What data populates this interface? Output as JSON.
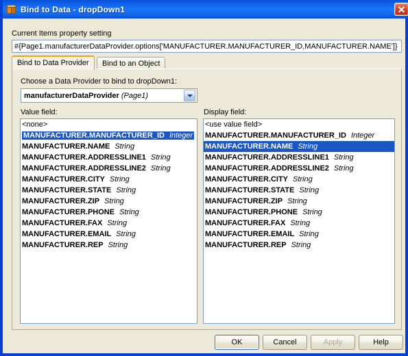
{
  "window": {
    "title": "Bind to Data - dropDown1",
    "icon": "cube-icon",
    "close_label": "×"
  },
  "property": {
    "label": "Current Items property setting",
    "value": "#{Page1.manufacturerDataProvider.options['MANUFACTURER.MANUFACTURER_ID,MANUFACTURER.NAME']}"
  },
  "tabs": [
    {
      "label": "Bind to Data Provider",
      "active": true
    },
    {
      "label": "Bind to an Object",
      "active": false
    }
  ],
  "provider": {
    "label": "Choose a Data Provider to bind to dropDown1:",
    "selected_name": "manufacturerDataProvider",
    "selected_scope": "(Page1)"
  },
  "value_field": {
    "label": "Value field:",
    "items": [
      {
        "name": "<none>",
        "type": "",
        "plain": true,
        "selected": false
      },
      {
        "name": "MANUFACTURER.MANUFACTURER_ID",
        "type": "Integer",
        "selected": true
      },
      {
        "name": "MANUFACTURER.NAME",
        "type": "String",
        "selected": false
      },
      {
        "name": "MANUFACTURER.ADDRESSLINE1",
        "type": "String",
        "selected": false
      },
      {
        "name": "MANUFACTURER.ADDRESSLINE2",
        "type": "String",
        "selected": false
      },
      {
        "name": "MANUFACTURER.CITY",
        "type": "String",
        "selected": false
      },
      {
        "name": "MANUFACTURER.STATE",
        "type": "String",
        "selected": false
      },
      {
        "name": "MANUFACTURER.ZIP",
        "type": "String",
        "selected": false
      },
      {
        "name": "MANUFACTURER.PHONE",
        "type": "String",
        "selected": false
      },
      {
        "name": "MANUFACTURER.FAX",
        "type": "String",
        "selected": false
      },
      {
        "name": "MANUFACTURER.EMAIL",
        "type": "String",
        "selected": false
      },
      {
        "name": "MANUFACTURER.REP",
        "type": "String",
        "selected": false
      }
    ]
  },
  "display_field": {
    "label": "Display field:",
    "items": [
      {
        "name": "<use value field>",
        "type": "",
        "plain": true,
        "selected": false
      },
      {
        "name": "MANUFACTURER.MANUFACTURER_ID",
        "type": "Integer",
        "selected": false
      },
      {
        "name": "MANUFACTURER.NAME",
        "type": "String",
        "selected": true
      },
      {
        "name": "MANUFACTURER.ADDRESSLINE1",
        "type": "String",
        "selected": false
      },
      {
        "name": "MANUFACTURER.ADDRESSLINE2",
        "type": "String",
        "selected": false
      },
      {
        "name": "MANUFACTURER.CITY",
        "type": "String",
        "selected": false
      },
      {
        "name": "MANUFACTURER.STATE",
        "type": "String",
        "selected": false
      },
      {
        "name": "MANUFACTURER.ZIP",
        "type": "String",
        "selected": false
      },
      {
        "name": "MANUFACTURER.PHONE",
        "type": "String",
        "selected": false
      },
      {
        "name": "MANUFACTURER.FAX",
        "type": "String",
        "selected": false
      },
      {
        "name": "MANUFACTURER.EMAIL",
        "type": "String",
        "selected": false
      },
      {
        "name": "MANUFACTURER.REP",
        "type": "String",
        "selected": false
      }
    ]
  },
  "buttons": [
    {
      "label": "OK",
      "default": true,
      "disabled": false
    },
    {
      "label": "Cancel",
      "default": false,
      "disabled": false
    },
    {
      "label": "Apply",
      "default": false,
      "disabled": true
    },
    {
      "label": "Help",
      "default": false,
      "disabled": false
    }
  ],
  "colors": {
    "titlebar_blue": "#1468ef",
    "window_border": "#0a3fd4",
    "panel_bg": "#ece9d8",
    "selection_blue": "#1a56c4",
    "active_tab_accent": "#f0a21e",
    "close_red": "#d8452a"
  }
}
